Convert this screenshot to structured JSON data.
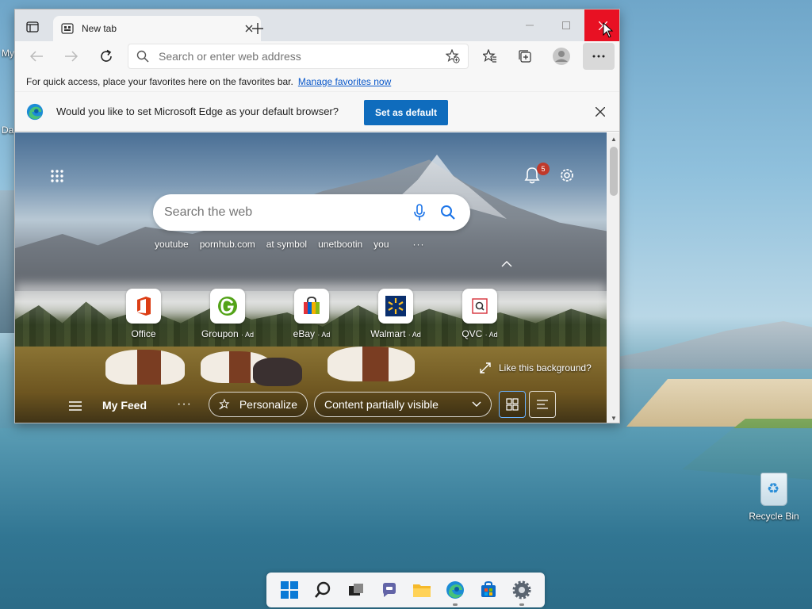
{
  "desktop": {
    "left_labels": [
      "My",
      "Da"
    ],
    "recycle_bin_label": "Recycle Bin"
  },
  "browser": {
    "tab_title": "New tab",
    "address_placeholder": "Search or enter web address",
    "favorites_bar": {
      "text": "For quick access, place your favorites here on the favorites bar.",
      "link": "Manage favorites now"
    },
    "infobar": {
      "message": "Would you like to set Microsoft Edge as your default browser?",
      "button": "Set as default"
    }
  },
  "newtab": {
    "search_placeholder": "Search the web",
    "notification_count": "5",
    "quick_searches": [
      "youtube",
      "pornhub.com",
      "at symbol",
      "unetbootin",
      "you"
    ],
    "quick_more": "···",
    "tiles": [
      {
        "name": "Office",
        "ad": ""
      },
      {
        "name": "Groupon",
        "ad": "· Ad"
      },
      {
        "name": "eBay",
        "ad": "· Ad"
      },
      {
        "name": "Walmart",
        "ad": "· Ad"
      },
      {
        "name": "QVC",
        "ad": "· Ad"
      }
    ],
    "like_background": "Like this background?",
    "feed": {
      "title": "My Feed",
      "more": "···",
      "personalize": "Personalize",
      "content_visibility": "Content partially visible"
    }
  },
  "colors": {
    "accent": "#0f6cbd",
    "close_hover": "#e81123",
    "badge": "#c0392b"
  }
}
